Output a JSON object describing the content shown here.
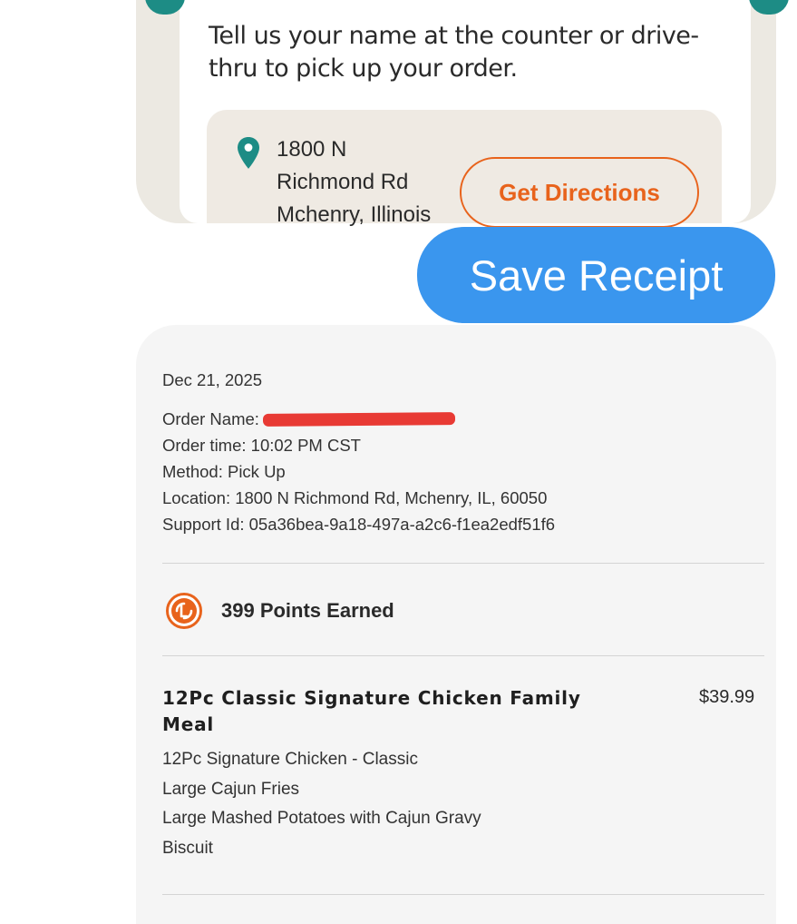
{
  "pickup": {
    "instructions": "Tell us your name at the counter or drive-thru to pick up your order.",
    "address_lines": [
      "1800 N",
      "Richmond Rd",
      "Mchenry, Illinois"
    ],
    "directions_label": "Get Directions"
  },
  "save_receipt_label": "Save Receipt",
  "receipt": {
    "date": "Dec 21, 2025",
    "order_name": "Order Name:",
    "order_time": "Order time: 10:02 PM CST",
    "method": "Method:  Pick Up",
    "location": "Location: 1800 N Richmond Rd, Mchenry, IL, 60050",
    "support_id": "Support Id: 05a36bea-9a18-497a-a2c6-f1ea2edf51f6",
    "points": "399 Points Earned",
    "item": {
      "name": "12Pc Classic Signature Chicken Family Meal",
      "price": "$39.99",
      "components": [
        "12Pc Signature Chicken - Classic",
        "Large Cajun Fries",
        "Large Mashed Potatoes with Cajun Gravy",
        "Biscuit"
      ]
    }
  },
  "colors": {
    "accent_orange": "#e8631c",
    "teal": "#1d8c85",
    "save_blue": "#3a96ee",
    "redaction": "#e83a34"
  },
  "icons": {
    "location": "map-pin-icon",
    "points": "rewards-points-icon"
  }
}
